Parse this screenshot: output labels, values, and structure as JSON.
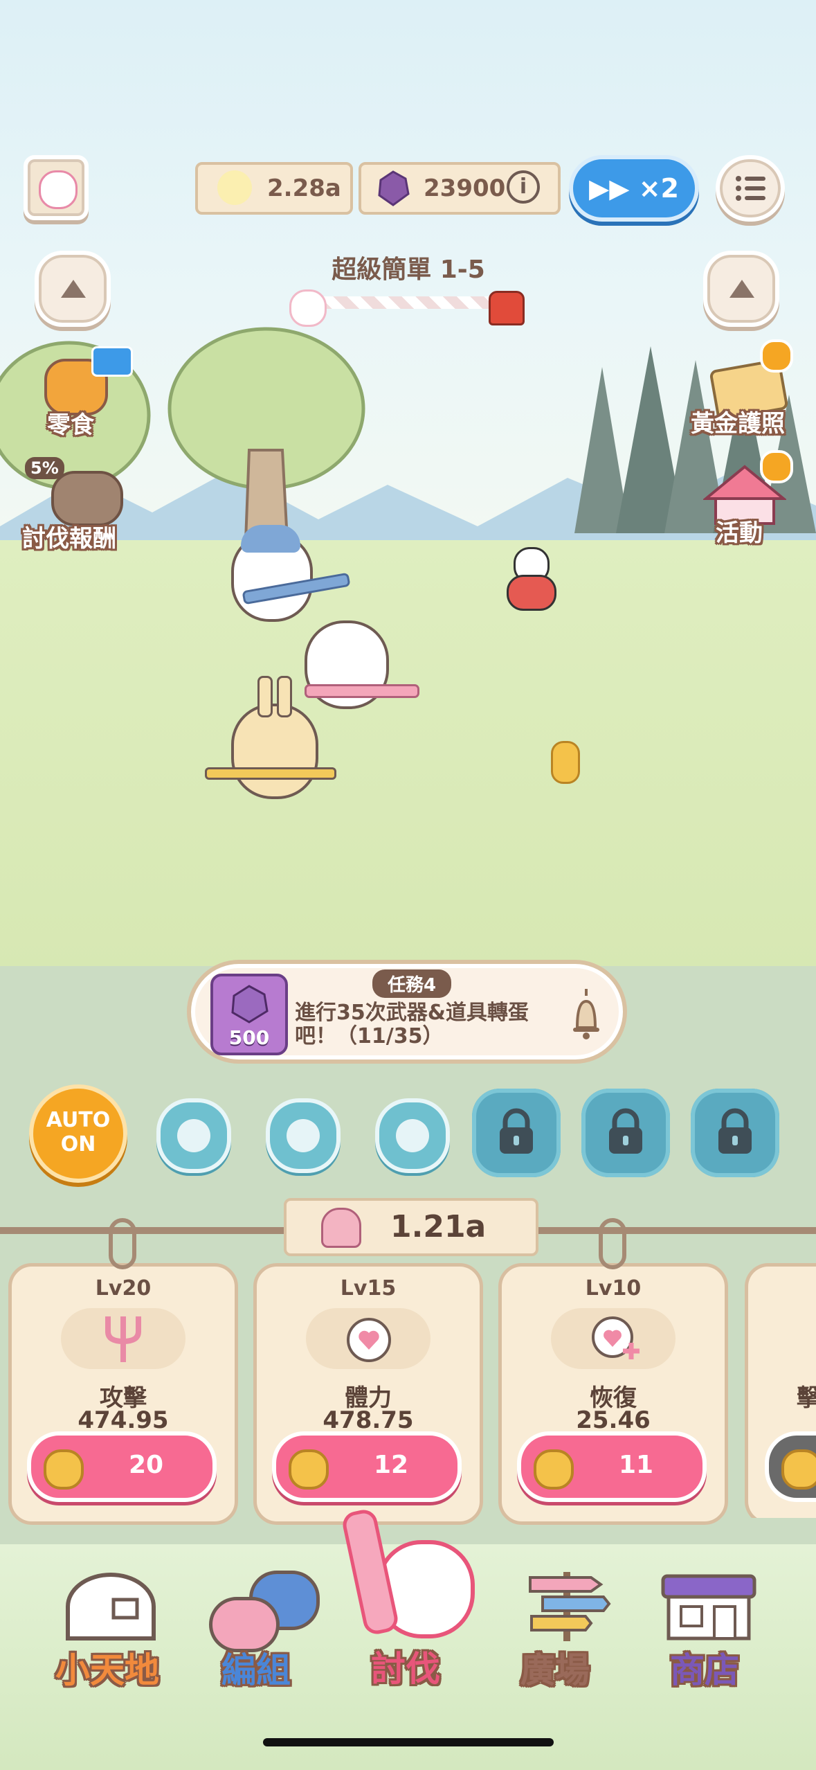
{
  "hud": {
    "gold": "2.28a",
    "gems": "23900",
    "speed": "▶▶ ×2"
  },
  "stage": {
    "title": "超級簡單 1-5"
  },
  "side": {
    "snack": "零食",
    "reward_percent": "5%",
    "reward": "討伐報酬",
    "passport": "黃金護照",
    "event": "活動"
  },
  "mission": {
    "badge": "任務4",
    "text": "進行35次武器&道具轉蛋吧！（11/35）",
    "gem_amount": "500"
  },
  "auto": {
    "line1": "AUTO",
    "line2": "ON"
  },
  "power": {
    "value": "1.21a"
  },
  "cards": [
    {
      "level": "Lv20",
      "name": "攻擊",
      "value": "474.95",
      "cost": "20"
    },
    {
      "level": "Lv15",
      "name": "體力",
      "value": "478.75",
      "cost": "12"
    },
    {
      "level": "Lv10",
      "name": "恢復",
      "value": "25.46",
      "cost": "11"
    },
    {
      "name": "擊"
    }
  ],
  "nav": {
    "home": "小天地",
    "team": "編組",
    "battle": "討伐",
    "plaza": "廣場",
    "shop": "商店"
  },
  "colors": {
    "accent_pink": "#f76a92",
    "speed_blue": "#3d9ae8",
    "auto_orange": "#f5a623",
    "nav_home": "#f28a3c",
    "nav_team": "#4a86d8",
    "nav_battle": "#e8557a",
    "nav_plaza": "#9a6a5a",
    "nav_shop": "#7b58b8"
  }
}
